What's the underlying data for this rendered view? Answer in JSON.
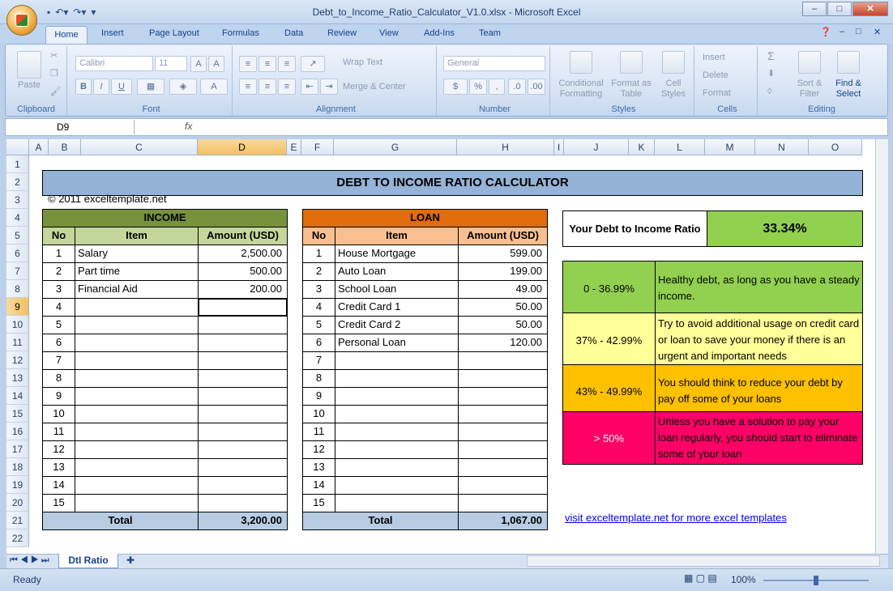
{
  "window": {
    "title": "Debt_to_Income_Ratio_Calculator_V1.0.xlsx - Microsoft Excel",
    "controls": [
      "–",
      "□",
      "✕"
    ]
  },
  "ribbon": {
    "tabs": [
      "Home",
      "Insert",
      "Page Layout",
      "Formulas",
      "Data",
      "Review",
      "View",
      "Add-Ins",
      "Team"
    ],
    "groups": {
      "clipboard": "Clipboard",
      "font": "Font",
      "alignment": "Alignment",
      "number": "Number",
      "styles": "Styles",
      "cells": "Cells",
      "editing": "Editing"
    },
    "paste": "Paste",
    "font_name": "Calibri",
    "font_size": "11",
    "wrap_text": "Wrap Text",
    "merge_center": "Merge & Center",
    "number_format": "General",
    "conditional_formatting": "Conditional Formatting",
    "format_as_table": "Format as Table",
    "cell_styles": "Cell Styles",
    "insert": "Insert",
    "delete": "Delete",
    "format": "Format",
    "sort_filter": "Sort & Filter",
    "find_select": "Find & Select",
    "bold": "B",
    "italic": "I",
    "underline": "U",
    "currency": "$",
    "percent": "%",
    "comma": ","
  },
  "formula_bar": {
    "name_box": "D9",
    "fx": "fx",
    "formula": ""
  },
  "columns": [
    "A",
    "B",
    "C",
    "D",
    "E",
    "F",
    "G",
    "H",
    "I",
    "J",
    "K",
    "L",
    "M",
    "N",
    "O"
  ],
  "rows": [
    "1",
    "2",
    "3",
    "4",
    "5",
    "6",
    "7",
    "8",
    "9",
    "10",
    "11",
    "12",
    "13",
    "14",
    "15",
    "16",
    "17",
    "18",
    "19",
    "20",
    "21",
    "22"
  ],
  "sheet": {
    "title": "DEBT TO INCOME RATIO CALCULATOR",
    "copyright": "© 2011 exceltemplate.net",
    "income": {
      "header": "INCOME",
      "col_no": "No",
      "col_item": "Item",
      "col_amount": "Amount (USD)",
      "rows": [
        {
          "no": "1",
          "item": "Salary",
          "amount": "2,500.00"
        },
        {
          "no": "2",
          "item": "Part time",
          "amount": "500.00"
        },
        {
          "no": "3",
          "item": "Financial Aid",
          "amount": "200.00"
        },
        {
          "no": "4",
          "item": "",
          "amount": ""
        },
        {
          "no": "5",
          "item": "",
          "amount": ""
        },
        {
          "no": "6",
          "item": "",
          "amount": ""
        },
        {
          "no": "7",
          "item": "",
          "amount": ""
        },
        {
          "no": "8",
          "item": "",
          "amount": ""
        },
        {
          "no": "9",
          "item": "",
          "amount": ""
        },
        {
          "no": "10",
          "item": "",
          "amount": ""
        },
        {
          "no": "11",
          "item": "",
          "amount": ""
        },
        {
          "no": "12",
          "item": "",
          "amount": ""
        },
        {
          "no": "13",
          "item": "",
          "amount": ""
        },
        {
          "no": "14",
          "item": "",
          "amount": ""
        },
        {
          "no": "15",
          "item": "",
          "amount": ""
        }
      ],
      "total_label": "Total",
      "total": "3,200.00"
    },
    "loan": {
      "header": "LOAN",
      "col_no": "No",
      "col_item": "Item",
      "col_amount": "Amount (USD)",
      "rows": [
        {
          "no": "1",
          "item": "House Mortgage",
          "amount": "599.00"
        },
        {
          "no": "2",
          "item": "Auto Loan",
          "amount": "199.00"
        },
        {
          "no": "3",
          "item": "School Loan",
          "amount": "49.00"
        },
        {
          "no": "4",
          "item": "Credit Card 1",
          "amount": "50.00"
        },
        {
          "no": "5",
          "item": "Credit Card 2",
          "amount": "50.00"
        },
        {
          "no": "6",
          "item": "Personal Loan",
          "amount": "120.00"
        },
        {
          "no": "7",
          "item": "",
          "amount": ""
        },
        {
          "no": "8",
          "item": "",
          "amount": ""
        },
        {
          "no": "9",
          "item": "",
          "amount": ""
        },
        {
          "no": "10",
          "item": "",
          "amount": ""
        },
        {
          "no": "11",
          "item": "",
          "amount": ""
        },
        {
          "no": "12",
          "item": "",
          "amount": ""
        },
        {
          "no": "13",
          "item": "",
          "amount": ""
        },
        {
          "no": "14",
          "item": "",
          "amount": ""
        },
        {
          "no": "15",
          "item": "",
          "amount": ""
        }
      ],
      "total_label": "Total",
      "total": "1,067.00"
    },
    "ratio_label": "Your Debt to Income Ratio",
    "ratio_value": "33.34%",
    "legend": [
      {
        "range": "0 - 36.99%",
        "text": "Healthy debt, as long as you have a steady income.",
        "color": "#92d050"
      },
      {
        "range": "37% - 42.99%",
        "text": "Try to avoid additional usage on credit card or loan to save your money if there is an urgent and important needs",
        "color": "#ffff99"
      },
      {
        "range": "43% - 49.99%",
        "text": "You should think to reduce your debt by pay off some of your loans",
        "color": "#ffc000"
      },
      {
        "range": "> 50%",
        "text": "Unless you have a solution to pay your loan regularly, you should start to eliminate some of your loan",
        "color": "#ff0066"
      }
    ],
    "link": "visit exceltemplate.net for more excel templates"
  },
  "sheet_tab": "DtI Ratio",
  "status": {
    "ready": "Ready",
    "zoom": "100%"
  },
  "colors": {
    "title_bg": "#95b3d7",
    "income_header": "#76923c",
    "income_sub": "#c4d79b",
    "loan_header": "#e26b0a",
    "loan_sub": "#fabf8f",
    "total_bg": "#b8cce4",
    "ratio_bg": "#92d050"
  }
}
